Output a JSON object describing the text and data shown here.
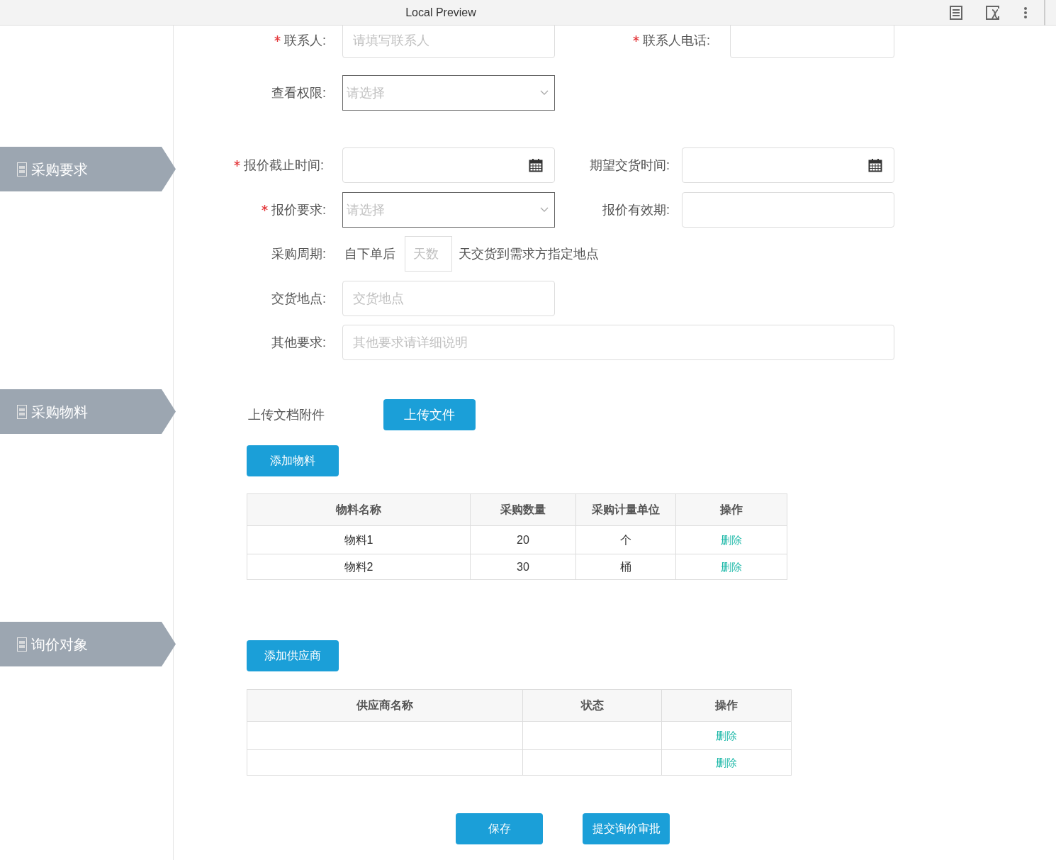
{
  "topbar": {
    "title": "Local Preview"
  },
  "sidebar": {
    "items": [
      {
        "label": "采购要求"
      },
      {
        "label": "采购物料"
      },
      {
        "label": "询价对象"
      }
    ]
  },
  "contact": {
    "contact_person": {
      "label": "联系人:",
      "required": true,
      "placeholder": "请填写联系人"
    },
    "contact_phone": {
      "label": "联系人电话:",
      "required": true
    }
  },
  "view_permission": {
    "label": "查看权限:",
    "required": false,
    "placeholder": "请选择"
  },
  "quote_deadline": {
    "label": "报价截止时间:",
    "required": true
  },
  "expected_delivery": {
    "label": "期望交货时间:",
    "required": false
  },
  "quote_requirement": {
    "label": "报价要求:",
    "required": true,
    "placeholder": "请选择"
  },
  "quote_validity": {
    "label": "报价有效期:",
    "required": false
  },
  "purchase_cycle": {
    "label": "采购周期:",
    "prefix": "自下单后",
    "placeholder": "天数",
    "suffix": "天交货到需求方指定地点"
  },
  "delivery_place": {
    "label": "交货地点:",
    "placeholder": "交货地点"
  },
  "other_requirements": {
    "label": "其他要求:",
    "placeholder": "其他要求请详细说明"
  },
  "upload": {
    "label": "上传文档附件",
    "button": "上传文件"
  },
  "add_material_button": "添加物料",
  "materials_table": {
    "columns": [
      "物料名称",
      "采购数量",
      "采购计量单位",
      "操作"
    ],
    "rows": [
      {
        "name": "物料1",
        "quantity": "20",
        "unit": "个",
        "action": "删除"
      },
      {
        "name": "物料2",
        "quantity": "30",
        "unit": "桶",
        "action": "删除"
      }
    ]
  },
  "add_supplier_button": "添加供应商",
  "suppliers_table": {
    "columns": [
      "供应商名称",
      "状态",
      "操作"
    ],
    "rows": [
      {
        "action": "删除"
      },
      {
        "action": "删除"
      }
    ]
  },
  "footer_buttons": [
    "保存",
    "提交询价审批"
  ]
}
